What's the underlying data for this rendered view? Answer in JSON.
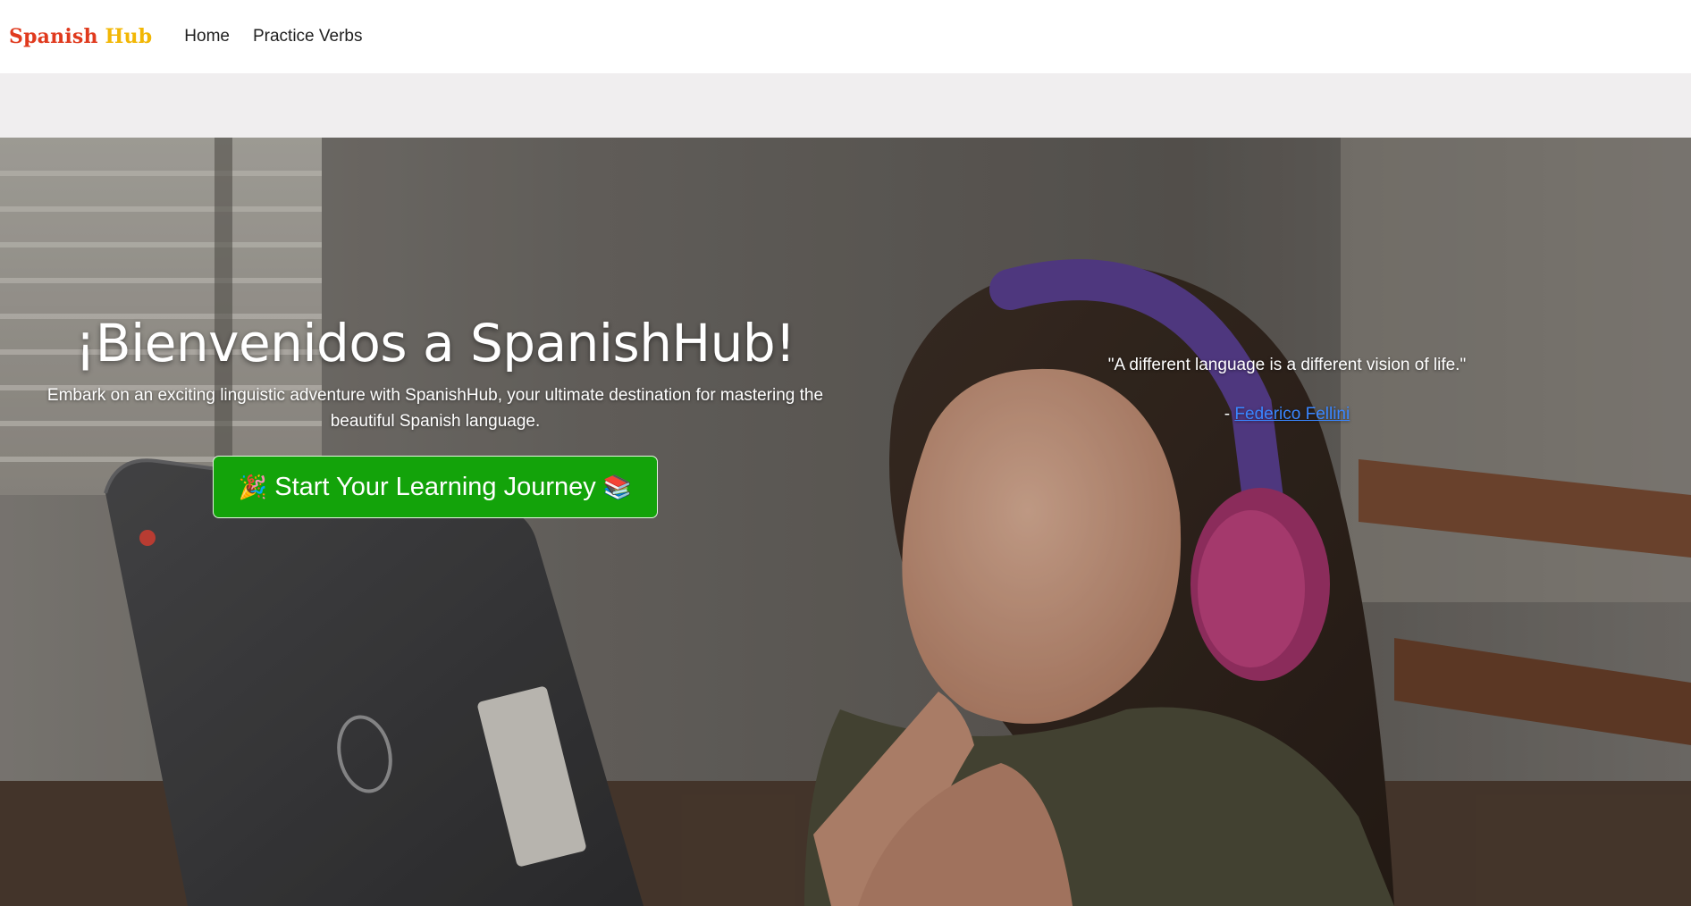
{
  "brand": {
    "word1": "Spanish",
    "word2": "Hub"
  },
  "nav": {
    "items": [
      {
        "label": "Home"
      },
      {
        "label": "Practice Verbs"
      }
    ]
  },
  "hero": {
    "title": "¡Bienvenidos a SpanishHub!",
    "subtitle_line1": "Embark on an exciting linguistic adventure with SpanishHub, your ultimate destination for mastering the",
    "subtitle_line2": "beautiful Spanish language.",
    "cta": {
      "emoji_left": "🎉",
      "label": "Start Your Learning Journey",
      "emoji_right": "📚"
    },
    "quote": {
      "text": "\"A different language is a different vision of life.\"",
      "author_prefix": "- ",
      "author": "Federico Fellini"
    },
    "background_image": "girl-with-headphones-at-laptop"
  },
  "colors": {
    "brand_red": "#e03a1e",
    "brand_yellow": "#f2b705",
    "cta_green": "#13a30a",
    "link_blue": "#3a86ff",
    "band_grey": "#f0eeef"
  }
}
